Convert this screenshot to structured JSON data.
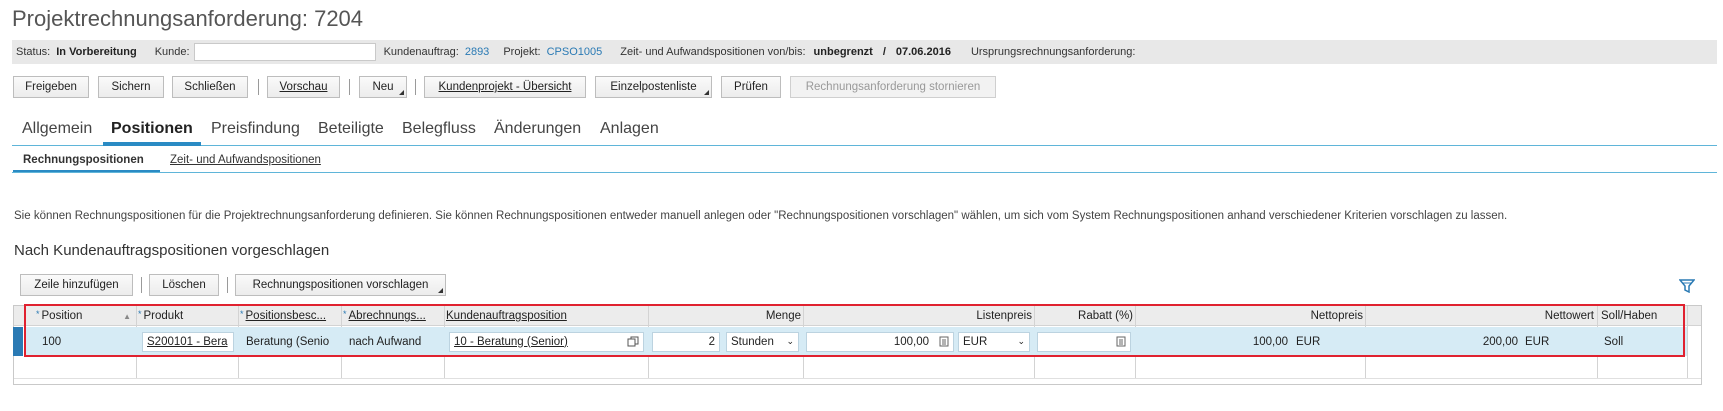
{
  "title": "Projektrechnungsanforderung: 7204",
  "status_bar": {
    "status_label": "Status:",
    "status_value": "In Vorbereitung",
    "kunde_label": "Kunde:",
    "kunde_value": "",
    "kundenauftrag_label": "Kundenauftrag:",
    "kundenauftrag_value": "2893",
    "projekt_label": "Projekt:",
    "projekt_value": "CPSO1005",
    "zeit_label": "Zeit- und Aufwandspositionen von/bis:",
    "zeit_from": "unbegrenzt",
    "zeit_sep": "/",
    "zeit_to": "07.06.2016",
    "ursprung_label": "Ursprungsrechnungsanforderung:"
  },
  "toolbar": {
    "freigeben": "Freigeben",
    "sichern": "Sichern",
    "schliessen": "Schließen",
    "vorschau": "Vorschau",
    "neu": "Neu",
    "kundenprojekt": "Kundenprojekt - Übersicht",
    "einzelposten": "Einzelpostenliste",
    "pruefen": "Prüfen",
    "stornieren": "Rechnungsanforderung stornieren"
  },
  "tabs": [
    "Allgemein",
    "Positionen",
    "Preisfindung",
    "Beteiligte",
    "Belegfluss",
    "Änderungen",
    "Anlagen"
  ],
  "subtabs": [
    "Rechnungspositionen",
    "Zeit- und Aufwandspositionen"
  ],
  "info_text": "Sie können Rechnungspositionen für die Projektrechnungsanforderung definieren. Sie können Rechnungspositionen entweder manuell anlegen oder \"Rechnungspositionen vorschlagen\" wählen, um sich vom System Rechnungspositionen anhand verschiedener Kriterien vorschlagen zu lassen.",
  "section_title": "Nach Kundenauftragspositionen vorgeschlagen",
  "table_toolbar": {
    "add_row": "Zeile hinzufügen",
    "delete": "Löschen",
    "suggest": "Rechnungspositionen vorschlagen"
  },
  "table": {
    "headers": {
      "position": "Position",
      "produkt": "Produkt",
      "positionsbesc": "Positionsbesc...",
      "abrechnungs": "Abrechnungs...",
      "kundenauftragsposition": "Kundenauftragsposition",
      "menge": "Menge",
      "listenpreis": "Listenpreis",
      "rabatt": "Rabatt (%)",
      "nettopreis": "Nettopreis",
      "nettowert": "Nettowert",
      "sollhaben": "Soll/Haben"
    },
    "row": {
      "position": "100",
      "produkt": "S200101 - Bera",
      "positionsbesc": "Beratung (Senio",
      "abrechnungs": "nach Aufwand",
      "kundenauftragsposition": "10 - Beratung (Senior)",
      "menge": "2",
      "einheit": "Stunden",
      "listenpreis": "100,00",
      "listenpreis_currency": "EUR",
      "rabatt": "",
      "nettopreis": "100,00",
      "nettopreis_currency": "EUR",
      "nettowert": "200,00",
      "nettowert_currency": "EUR",
      "sollhaben": "Soll"
    }
  },
  "colors": {
    "accent": "#2a7ab4",
    "tab_line": "#5fb5d9",
    "selected_row": "#d6ebf5",
    "highlight_box": "#e0212f"
  }
}
